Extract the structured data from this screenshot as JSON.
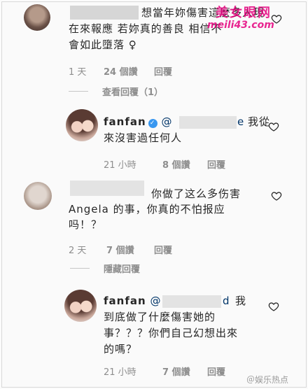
{
  "comment1": {
    "lines": [
      "想當年妳傷害這麼多人現",
      "在來報應 若妳真的善良 相信不",
      "會如此墮落 ♀"
    ],
    "time": "1 天",
    "likes": "24 個讚",
    "reply": "回覆",
    "view_replies": "查看回覆（1）"
  },
  "reply1": {
    "username": "fanfan",
    "mention": "@",
    "mention_tail": "e",
    "lines": [
      "我從",
      "來沒害過任何人"
    ],
    "time": "21 小時",
    "likes": "8 個讚",
    "reply": "回覆"
  },
  "comment2": {
    "lines": [
      "你做了这么多伤害",
      "Angela 的事，你真的不怕报应",
      "吗！？"
    ],
    "time": "2 天",
    "likes": "7 個讚",
    "reply": "回覆",
    "hide_replies": "隱藏回覆"
  },
  "reply2": {
    "username": "fanfan",
    "mention": "@",
    "mention_tail": "d",
    "lines": [
      "我",
      "到底做了什麼傷害她的",
      "事？？？你們自己幻想出來",
      "的嗎？"
    ],
    "time": "21 小時",
    "likes": "7 個讚",
    "reply": "回覆"
  },
  "watermark": {
    "top_brand": "美女眼网",
    "top_url": "meili43.com",
    "bottom": "＠娱乐热点"
  },
  "colors": {
    "accent_link": "#003569",
    "meta_gray": "#8e8e8e",
    "verified_blue": "#3897f0",
    "watermark_pink": "#e6007e"
  }
}
